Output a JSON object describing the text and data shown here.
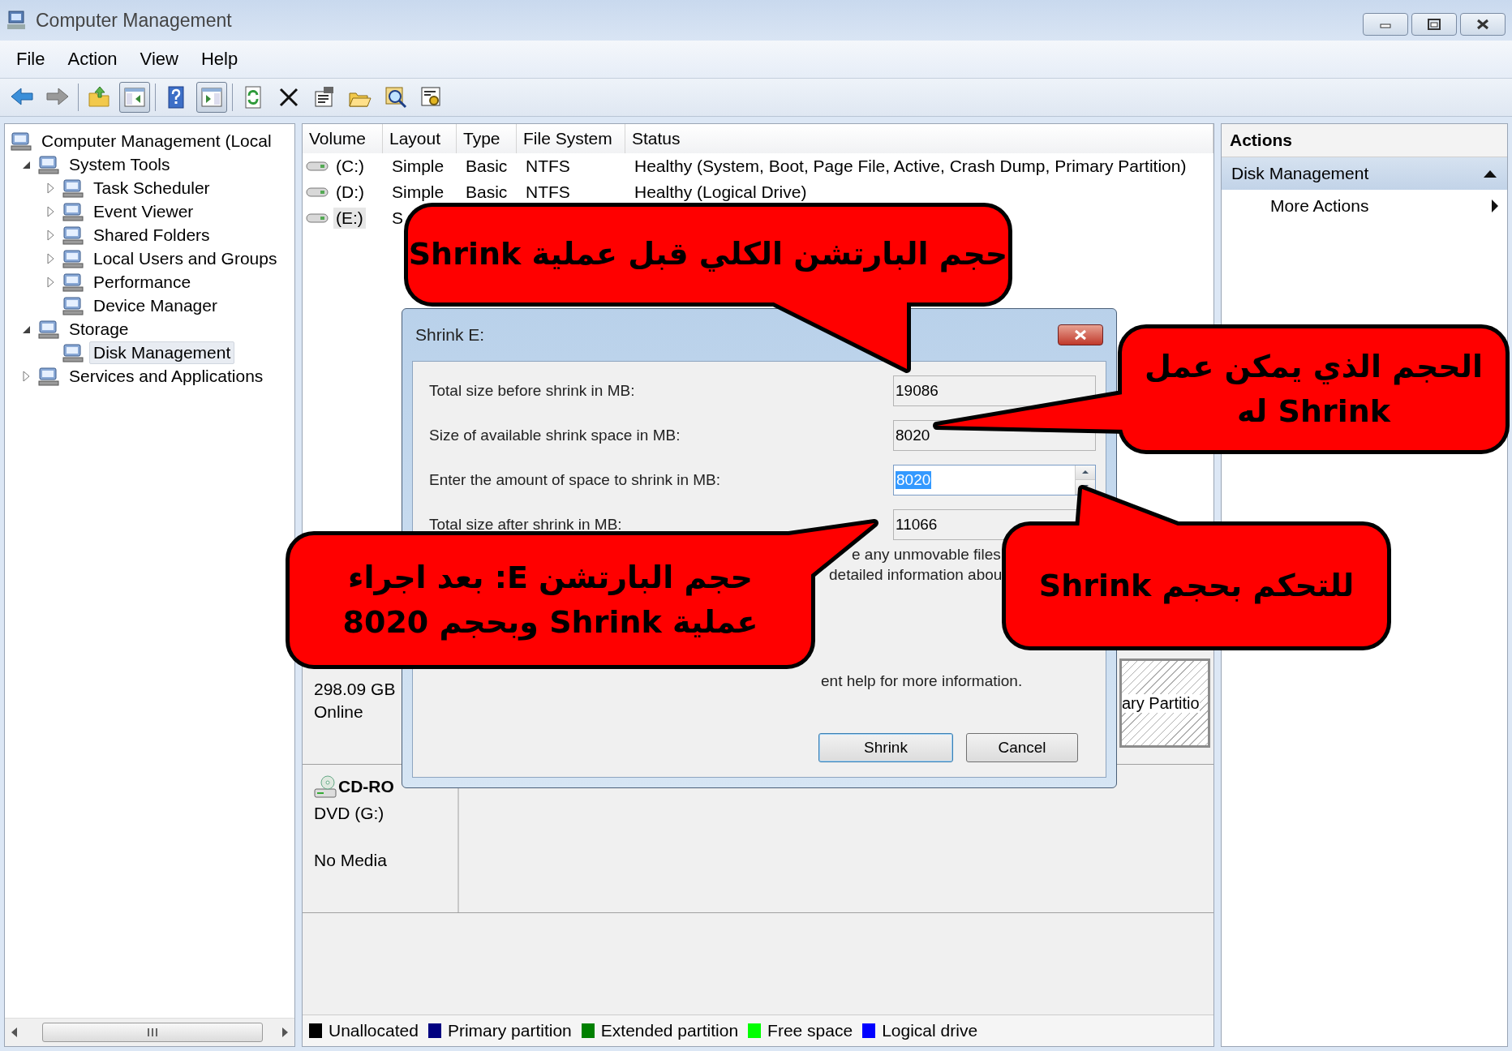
{
  "window": {
    "title": "Computer Management"
  },
  "window_controls": [
    {
      "kind": "minimize"
    },
    {
      "kind": "maximize"
    },
    {
      "kind": "close"
    }
  ],
  "menu": [
    "File",
    "Action",
    "View",
    "Help"
  ],
  "toolbar": [
    {
      "kind": "back",
      "pressed": false
    },
    {
      "kind": "forward",
      "pressed": false
    },
    {
      "kind": "separator"
    },
    {
      "kind": "up",
      "pressed": false
    },
    {
      "kind": "tree",
      "pressed": true
    },
    {
      "kind": "separator"
    },
    {
      "kind": "help",
      "pressed": false
    },
    {
      "kind": "pane",
      "pressed": true
    },
    {
      "kind": "separator"
    },
    {
      "kind": "refresh",
      "pressed": false
    },
    {
      "kind": "delete",
      "pressed": false
    },
    {
      "kind": "properties",
      "pressed": false
    },
    {
      "kind": "open",
      "pressed": false
    },
    {
      "kind": "find",
      "pressed": false
    },
    {
      "kind": "settings",
      "pressed": false
    }
  ],
  "tree": {
    "items": [
      {
        "label": "Computer Management (Local",
        "selected": false,
        "children": [
          {
            "label": "System Tools",
            "selected": false,
            "expanded": true,
            "children": [
              {
                "label": "Task Scheduler",
                "selected": false,
                "expanded": false
              },
              {
                "label": "Event Viewer",
                "selected": false,
                "expanded": false
              },
              {
                "label": "Shared Folders",
                "selected": false,
                "expanded": false
              },
              {
                "label": "Local Users and Groups",
                "selected": false,
                "expanded": false
              },
              {
                "label": "Performance",
                "selected": false,
                "expanded": false
              },
              {
                "label": "Device Manager",
                "selected": false
              }
            ]
          },
          {
            "label": "Storage",
            "selected": false,
            "expanded": true,
            "children": [
              {
                "label": "Disk Management",
                "selected": true
              }
            ]
          },
          {
            "label": "Services and Applications",
            "selected": false,
            "expanded": false
          }
        ]
      }
    ]
  },
  "volumes": {
    "columns": [
      "Volume",
      "Layout",
      "Type",
      "File System",
      "Status"
    ],
    "rows": [
      {
        "selected": false,
        "cells": [
          "(C:)",
          "Simple",
          "Basic",
          "NTFS",
          "Healthy (System, Boot, Page File, Active, Crash Dump, Primary Partition)"
        ]
      },
      {
        "selected": false,
        "cells": [
          "(D:)",
          "Simple",
          "Basic",
          "NTFS",
          "Healthy (Logical Drive)"
        ]
      },
      {
        "selected": true,
        "cells": [
          "(E:)",
          "S"
        ]
      }
    ]
  },
  "disks": [
    {
      "kind": "basic",
      "size": "298.09 GB",
      "status": "Online",
      "partition_fragment": "ary Partitio"
    },
    {
      "kind": "cdrom",
      "title": "CD-RO",
      "type": "DVD (G:)",
      "status": "No Media"
    }
  ],
  "legend": [
    {
      "label": "Unallocated",
      "color": "#000000"
    },
    {
      "label": "Primary partition",
      "color": "#000080"
    },
    {
      "label": "Extended partition",
      "color": "#008000"
    },
    {
      "label": "Free space",
      "color": "#00ff00"
    },
    {
      "label": "Logical drive",
      "color": "#0000ff"
    }
  ],
  "actions": {
    "title": "Actions",
    "sections": [
      {
        "label": "Disk Management",
        "expanded": true,
        "items": [
          {
            "label": "More Actions"
          }
        ]
      }
    ]
  },
  "dialog": {
    "title": "Shrink E:",
    "fields": [
      {
        "kind": "readonly",
        "label": "Total size before shrink in MB:",
        "value": "19086"
      },
      {
        "kind": "readonly",
        "label": "Size of available shrink space in MB:",
        "value": "8020"
      },
      {
        "kind": "spin",
        "label": "Enter the amount of space to shrink in MB:",
        "value": "8020"
      },
      {
        "kind": "readonly",
        "label": "Total size after shrink in MB:",
        "value": "11066"
      }
    ],
    "note_fragments": [
      "e any unmovable files",
      "detailed information abou",
      "ent help for more information."
    ],
    "buttons": [
      {
        "label": "Shrink",
        "default": true
      },
      {
        "label": "Cancel",
        "default": false
      }
    ]
  },
  "callouts": [
    {
      "lines": [
        "حجم البارتشن الكلي قبل عملية Shrink"
      ]
    },
    {
      "lines": [
        "الحجم الذي يمكن عمل",
        "Shrink له"
      ]
    },
    {
      "lines": [
        "للتحكم بحجم Shrink"
      ]
    },
    {
      "lines": [
        "حجم البارتشن E: بعد اجراء",
        "عملية Shrink وبحجم 8020"
      ]
    }
  ]
}
